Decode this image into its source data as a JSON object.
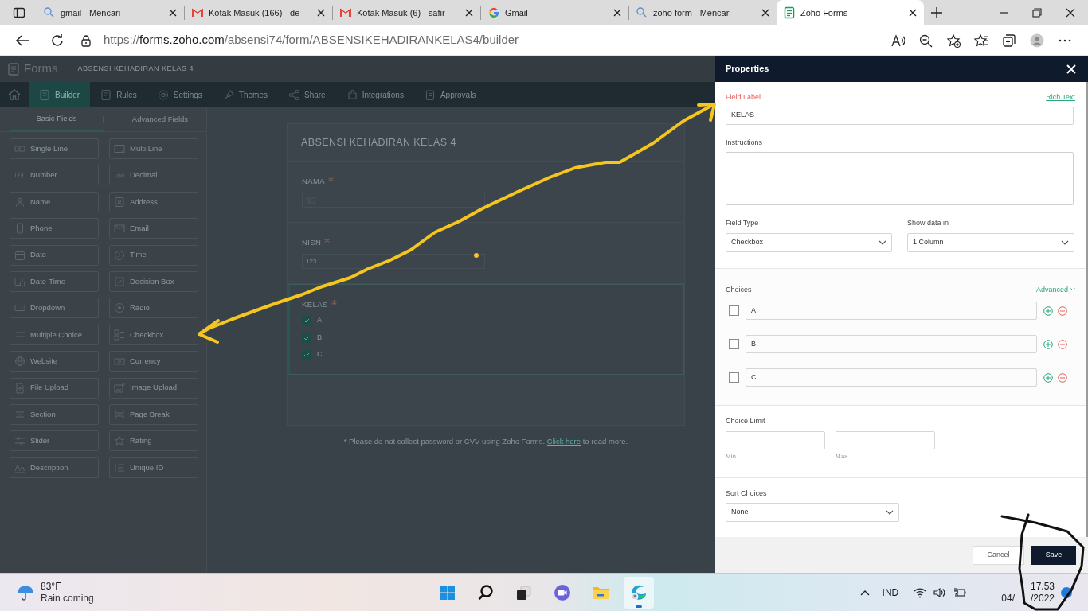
{
  "browser": {
    "tabs": [
      {
        "kind": "search",
        "title": "gmail - Mencari",
        "selected": false
      },
      {
        "kind": "mail",
        "title": "Kotak Masuk (166) - de",
        "selected": false
      },
      {
        "kind": "mail",
        "title": "Kotak Masuk (6) - safir",
        "selected": false
      },
      {
        "kind": "google",
        "title": "Gmail",
        "selected": false
      },
      {
        "kind": "search",
        "title": "zoho form - Mencari",
        "selected": false
      },
      {
        "kind": "forms",
        "title": "Zoho Forms",
        "selected": true
      }
    ],
    "url": {
      "scheme": "https://",
      "host": "forms.zoho.com",
      "path": "/absensi74/form/ABSENSIKEHADIRANKELAS4/builder"
    }
  },
  "app": {
    "logo": "Forms",
    "form_name": "ABSENSI KEHADIRAN KELAS 4",
    "nav": [
      {
        "label": "Builder",
        "selected": true
      },
      {
        "label": "Rules",
        "selected": false
      },
      {
        "label": "Settings",
        "selected": false
      },
      {
        "label": "Themes",
        "selected": false
      },
      {
        "label": "Share",
        "selected": false
      },
      {
        "label": "Integrations",
        "selected": false
      },
      {
        "label": "Approvals",
        "selected": false
      }
    ],
    "field_tabs": [
      {
        "label": "Basic Fields",
        "selected": true
      },
      {
        "label": "Advanced Fields",
        "selected": false
      }
    ],
    "fields": [
      "Single Line",
      "Multi Line",
      "Number",
      "Decimal",
      "Name",
      "Address",
      "Phone",
      "Email",
      "Date",
      "Time",
      "Date-Time",
      "Decision Box",
      "Dropdown",
      "Radio",
      "Multiple Choice",
      "Checkbox",
      "Website",
      "Currency",
      "File Upload",
      "Image Upload",
      "Section",
      "Page Break",
      "Slider",
      "Rating",
      "Description",
      "Unique ID"
    ],
    "form": {
      "title": "ABSENSI KEHADIRAN KELAS 4",
      "fields": [
        {
          "kind": "text",
          "label": "NAMA",
          "required": true,
          "selected": false
        },
        {
          "kind": "number",
          "label": "NISN",
          "required": true,
          "selected": false,
          "placeholder": "123"
        },
        {
          "kind": "checkbox",
          "label": "KELAS",
          "required": true,
          "selected": true,
          "options": [
            {
              "label": "A",
              "checked": true
            },
            {
              "label": "B",
              "checked": true
            },
            {
              "label": "C",
              "checked": true
            }
          ]
        }
      ]
    },
    "footnote": {
      "before": "* Please do not collect password or CVV using Zoho Forms.",
      "link": "Click here",
      "after": "to read more."
    }
  },
  "properties": {
    "title": "Properties",
    "field_label": {
      "label": "Field Label",
      "value": "KELAS"
    },
    "rich_text": "Rich Text",
    "instructions": {
      "label": "Instructions"
    },
    "field_type": {
      "label": "Field Type",
      "value": "Checkbox"
    },
    "show_data_in": {
      "label": "Show data in",
      "value": "1 Column"
    },
    "choices": {
      "label": "Choices",
      "advanced": "Advanced",
      "items": [
        {
          "value": "A",
          "checked": false
        },
        {
          "value": "B",
          "checked": false
        },
        {
          "value": "C",
          "checked": false
        }
      ]
    },
    "choice_limit": {
      "label": "Choice Limit",
      "min": "Min",
      "max": "Max"
    },
    "sort_choices": {
      "label": "Sort Choices",
      "value": "None"
    },
    "buttons": {
      "cancel": "Cancel",
      "save": "Save"
    }
  },
  "taskbar": {
    "temperature": "83°F",
    "forecast": "Rain coming",
    "language": "IND",
    "time": "17.53",
    "date_parts": [
      "04/",
      "/2022"
    ]
  }
}
